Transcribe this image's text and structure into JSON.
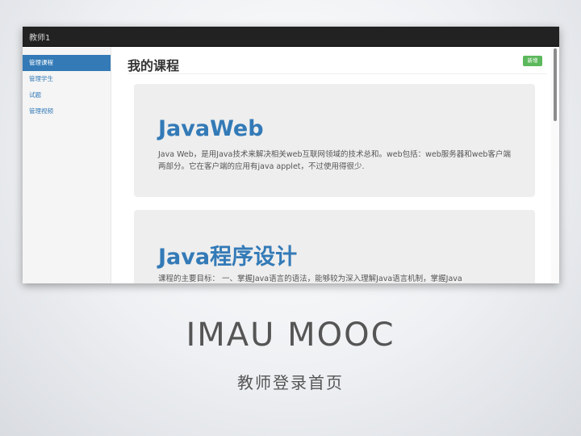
{
  "app": {
    "brand": "教师1"
  },
  "sidebar": {
    "items": [
      {
        "label": "管理课程",
        "active": true
      },
      {
        "label": "管理学生",
        "active": false
      },
      {
        "label": "试题",
        "active": false
      },
      {
        "label": "管理视频",
        "active": false
      }
    ]
  },
  "main": {
    "title": "我的课程",
    "add_button": "新增",
    "courses": [
      {
        "title": "JavaWeb",
        "description": "Java Web，是用Java技术来解决相关web互联网领域的技术总和。web包括：web服务器和web客户端两部分。它在客户端的应用有java applet，不过使用得很少."
      },
      {
        "title": "Java程序设计",
        "description": "课程的主要目标： 一、掌握Java语言的语法，能够较为深入理解Java语言机制，掌握Java"
      }
    ]
  },
  "slide": {
    "title": "IMAU MOOC",
    "subtitle": "教师登录首页"
  },
  "colors": {
    "navbar": "#222222",
    "primary": "#337ab7",
    "success": "#5cb85c",
    "card_bg": "#eeeeee"
  }
}
